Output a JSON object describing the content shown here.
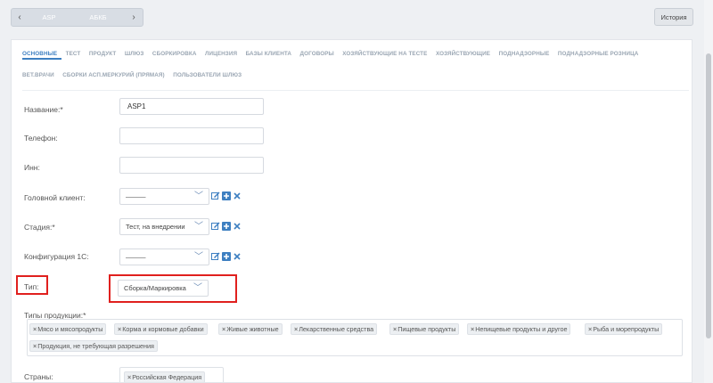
{
  "topbar": {
    "prev": "‹",
    "current": "ASP",
    "next_record": "АБКБ",
    "next": "›",
    "history_label": "История"
  },
  "tabs": {
    "row1": [
      "ОСНОВНЫЕ",
      "ТЕСТ",
      "ПРОДУКТ",
      "ШЛЮЗ",
      "СБОРКИРОВКА",
      "ЛИЦЕНЗИЯ",
      "БАЗЫ КЛИЕНТА",
      "ДОГОВОРЫ",
      "ХОЗЯЙСТВУЮЩИЕ НА ТЕСТЕ",
      "ХОЗЯЙСТВУЮЩИЕ",
      "ПОДНАДЗОРНЫЕ",
      "ПОДНАДЗОРНЫЕ РОЗНИЦА"
    ],
    "row2": [
      "ВЕТ.ВРАЧИ",
      "СБОРКИ АСП.МЕРКУРИЙ (ПРЯМАЯ)",
      "ПОЛЬЗОВАТЕЛИ ШЛЮЗ"
    ]
  },
  "form": {
    "name_label": "Название:*",
    "name_value": "ASP1",
    "phone_label": "Телефон:",
    "phone_value": "",
    "inn_label": "Инн:",
    "inn_value": "",
    "head_client_label": "Головной клиент:",
    "head_client_value": "———",
    "stage_label": "Стадия:*",
    "stage_value": "Тест, на внедрении",
    "config_label": "Конфигурация 1С:",
    "config_value": "———",
    "type_label": "Тип:",
    "type_value": "Сборка/Маркировка",
    "product_types_label": "Типы продукции:*",
    "product_types": [
      "Мясо и мясопродукты",
      "Корма и кормовые добавки",
      "Живые животные",
      "Лекарственные средства",
      "Пищевые продукты",
      "Непищевые продукты и другое",
      "Рыба и морепродукты",
      "Продукция, не требующая разрешения"
    ],
    "countries_label": "Страны:",
    "countries": [
      "Российская Федерация"
    ]
  },
  "icons": {
    "edit": "edit-icon",
    "add": "plus-icon",
    "remove": "close-icon"
  },
  "colors": {
    "accent": "#3d7fc1",
    "highlight": "#e0201e"
  }
}
